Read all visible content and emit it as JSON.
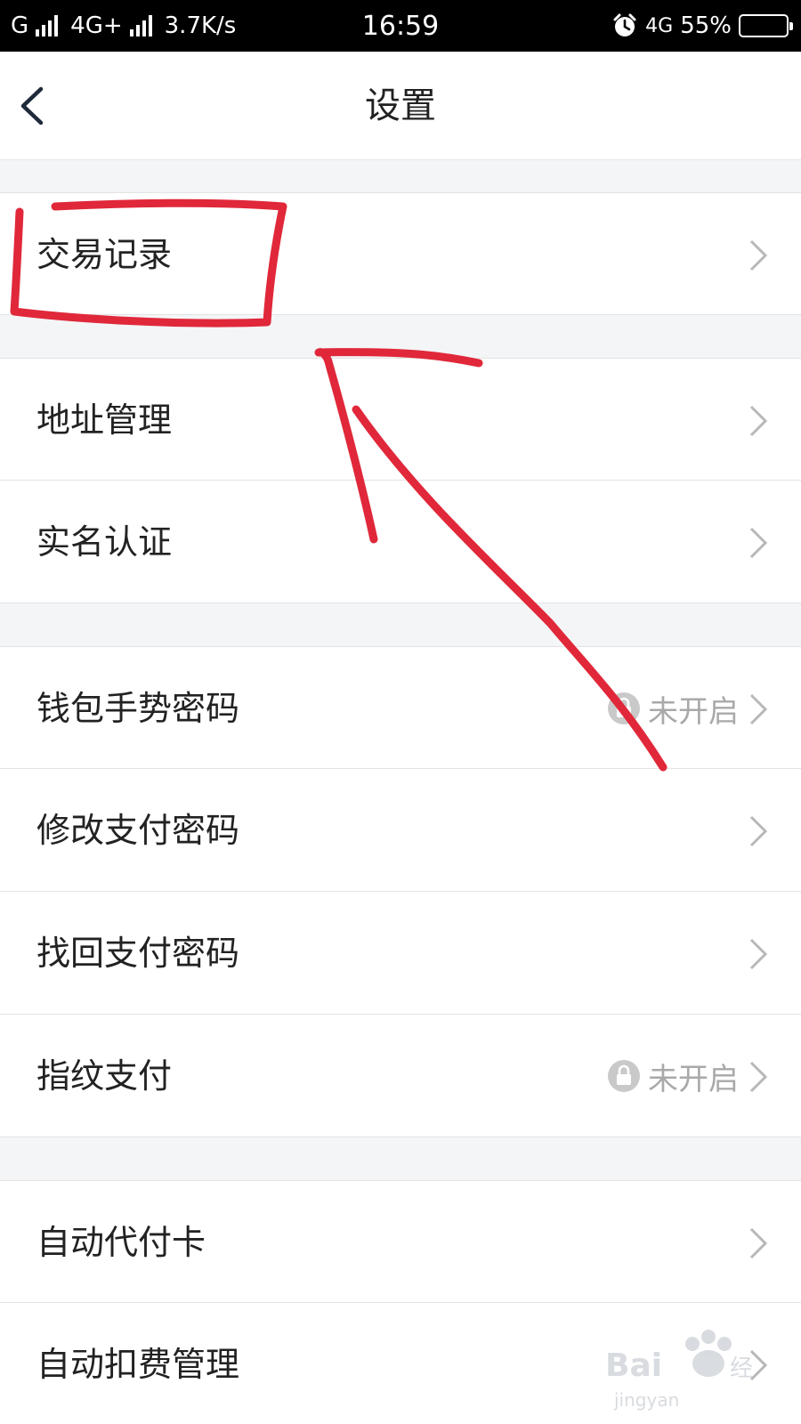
{
  "status_bar": {
    "carrier1": "G",
    "carrier2": "4G+",
    "net_speed": "3.7K/s",
    "time": "16:59",
    "net_right": "4G",
    "battery_pct": "55%",
    "battery_level": 0.55,
    "icons": [
      "signal-icon",
      "alarm-icon",
      "battery-icon"
    ]
  },
  "nav": {
    "title": "设置",
    "back_icon": "chevron-left-icon"
  },
  "rows": [
    {
      "label": "交易记录"
    },
    {
      "label": "地址管理"
    },
    {
      "label": "实名认证"
    },
    {
      "label": "钱包手势密码",
      "status": "未开启"
    },
    {
      "label": "修改支付密码"
    },
    {
      "label": "找回支付密码"
    },
    {
      "label": "指纹支付",
      "status": "未开启"
    },
    {
      "label": "自动代付卡"
    },
    {
      "label": "自动扣费管理"
    }
  ],
  "colors": {
    "annotation_red": "#e0283a",
    "status_gray": "#a9a9a9",
    "battery_yellow": "#f5c518"
  }
}
